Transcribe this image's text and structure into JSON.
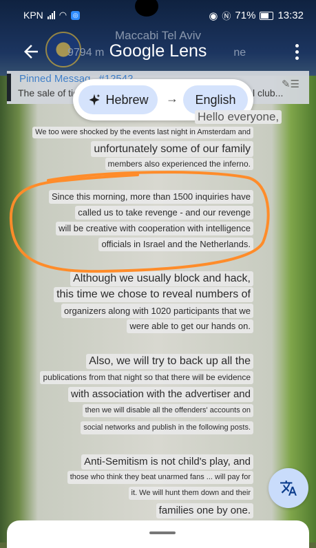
{
  "status_bar": {
    "carrier": "KPN",
    "battery": "71%",
    "time": "13:32"
  },
  "chat_header": {
    "channel_name": "Maccabi Tel Aviv",
    "subtitle_visible": "9794 m",
    "subtitle_end": "ne"
  },
  "lens": {
    "title": "Google Lens"
  },
  "pinned": {
    "title": "Pinned Messag",
    "title_end": "#12542",
    "body": "The sale of tick",
    "body_end": "l club..."
  },
  "translate": {
    "source": "Hebrew",
    "target": "English"
  },
  "lines": [
    "Hello everyone,",
    "We too were shocked by the events last night in Amsterdam and",
    "unfortunately some of our family",
    "members also experienced the inferno.",
    "Since this morning, more than 1500 inquiries have",
    "called us to take revenge - and our revenge",
    "will be creative with cooperation with intelligence",
    "officials in Israel and the Netherlands.",
    "Although we usually block and hack,",
    "this time we chose to reveal numbers of",
    "organizers along with 1020 participants that we",
    "were able to get our hands on.",
    "Also, we will try to back up all the",
    "publications from that night so that there will be evidence",
    "with association with the advertiser and",
    "then we will disable all the offenders' accounts on",
    "social networks and publish in the following posts.",
    "Anti-Semitism is not child's play, and",
    "those who think they beat unarmed fans ... will pay for",
    "it. We will hunt them down and their",
    "families one by one."
  ],
  "colors": {
    "highlight": "#ff8c2a",
    "chip": "#d5e3fc",
    "fab": "#c9dcfb",
    "pinned_title": "#3a7cc9"
  },
  "icons": {
    "back": "arrow-left-icon",
    "menu": "more-vert-icon",
    "sparkle": "sparkle-icon",
    "arrow": "arrow-right-icon",
    "translate": "translate-icon",
    "pin": "pin-icon"
  }
}
